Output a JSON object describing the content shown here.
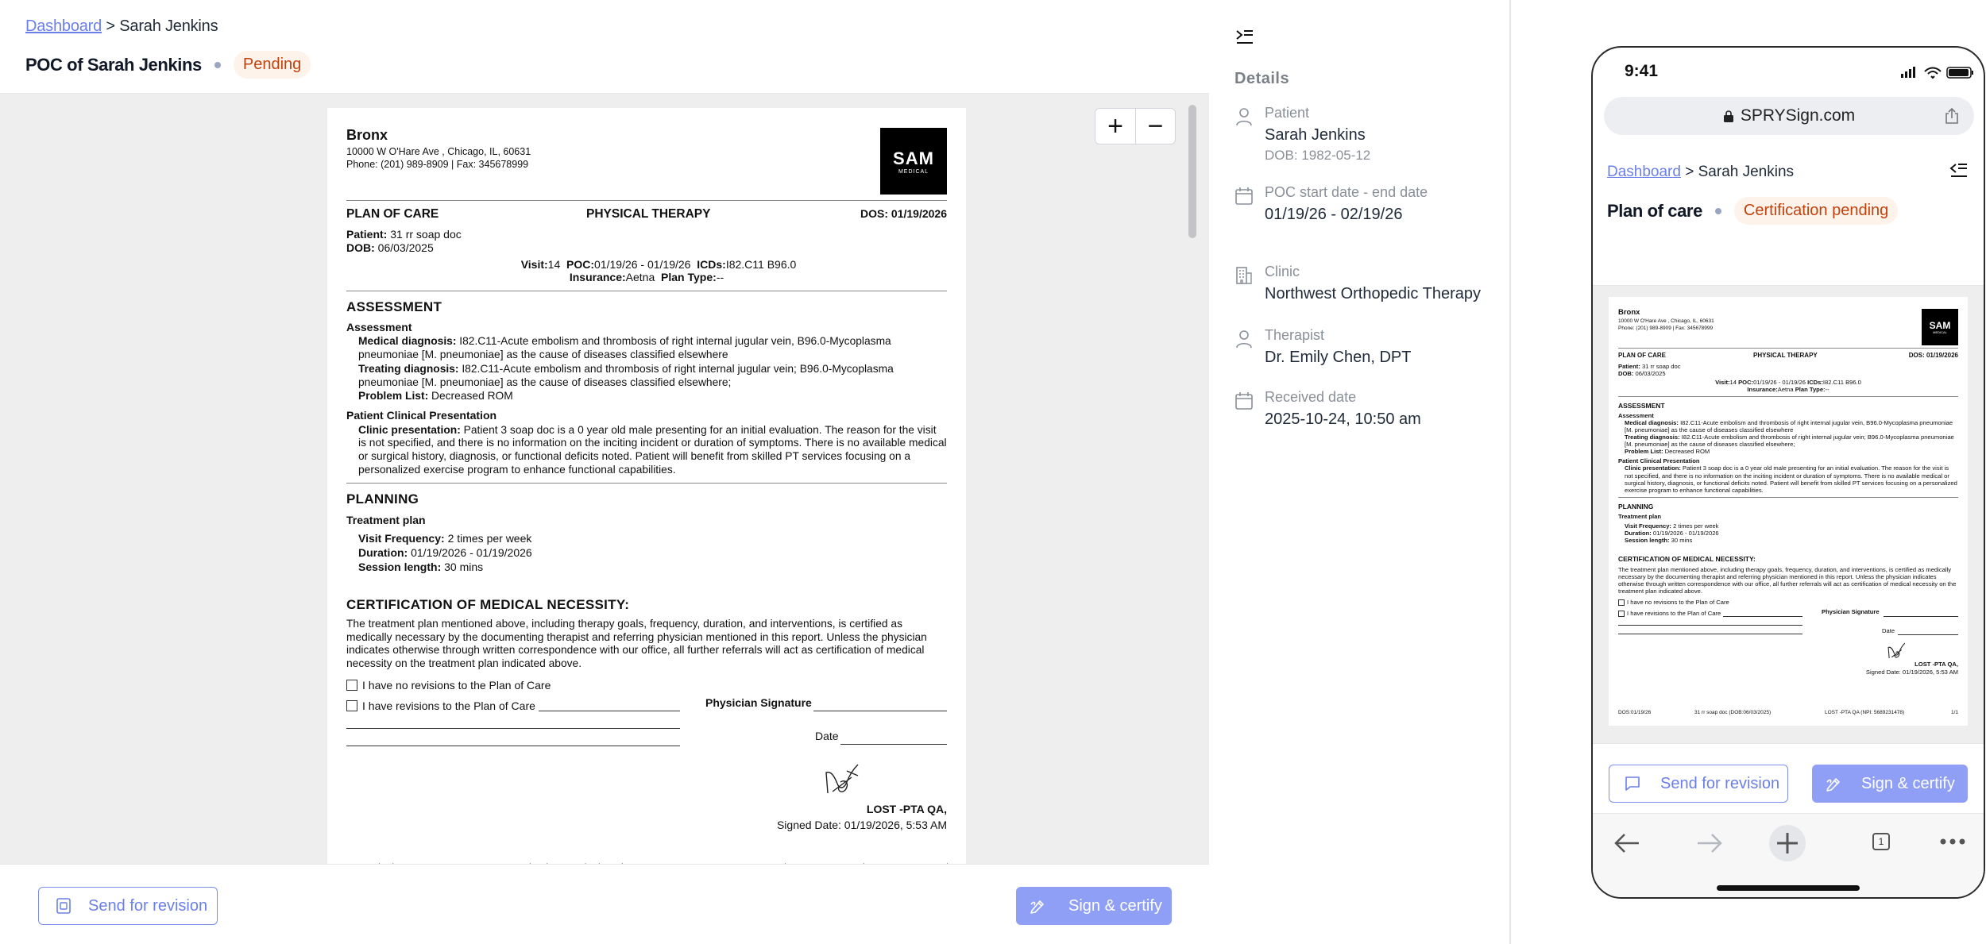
{
  "breadcrumb": {
    "link": "Dashboard",
    "separator": ">",
    "current": "Sarah Jenkins"
  },
  "header": {
    "title": "POC of Sarah Jenkins",
    "status": "Pending"
  },
  "zoom": {
    "plus": "+",
    "minus": "−"
  },
  "document": {
    "clinic_name": "Bronx",
    "address": "10000 W O'Hare Ave , Chicago, IL, 60631",
    "phone_fax": "Phone: (201) 989-8909 | Fax: 345678999",
    "logo_text": "SAM",
    "logo_sub": "MEDICAL",
    "plan_title": "PLAN OF CARE",
    "discipline": "PHYSICAL THERAPY",
    "dos": "DOS: 01/19/2026",
    "patient_label": "Patient:",
    "patient_value": "31 rr soap doc",
    "dob_label": "DOB:",
    "dob_value": "06/03/2025",
    "visit_label": "Visit:",
    "visit_value": "14",
    "poc_label": "POC:",
    "poc_value": "01/19/26 - 01/19/26",
    "icds_label": "ICDs:",
    "icds_value": "I82.C11 B96.0",
    "insurance_label": "Insurance:",
    "insurance_value": "Aetna",
    "plantype_label": "Plan Type:",
    "plantype_value": "--",
    "assessment_heading": "ASSESSMENT",
    "assessment_sub": "Assessment",
    "medical_dx_label": "Medical diagnosis:",
    "medical_dx_value": "I82.C11-Acute embolism and thrombosis of right internal jugular vein, B96.0-Mycoplasma pneumoniae [M. pneumoniae] as the cause of diseases classified elsewhere",
    "treating_dx_label": "Treating diagnosis:",
    "treating_dx_value": "I82.C11-Acute embolism and thrombosis of right internal jugular vein; B96.0-Mycoplasma pneumoniae [M. pneumoniae] as the cause of diseases classified elsewhere;",
    "problem_label": "Problem List:",
    "problem_value": "Decreased ROM",
    "clinical_heading": "Patient Clinical Presentation",
    "clinical_label": "Clinic presentation:",
    "clinical_value": "Patient 3 soap doc is a 0 year old male presenting for an initial evaluation. The reason for the visit is not specified, and there is no information on the inciting incident or duration of symptoms. There is no available medical or surgical history, diagnosis, or functional deficits noted. Patient will benefit from skilled PT services focusing on a personalized exercise program to enhance functional capabilities.",
    "planning_heading": "PLANNING",
    "treatment_plan": "Treatment plan",
    "freq_label": "Visit Frequency:",
    "freq_value": "2 times per week",
    "duration_label": "Duration:",
    "duration_value": "01/19/2026 - 01/19/2026",
    "session_label": "Session length:",
    "session_value": "30 mins",
    "cert_heading": "CERTIFICATION OF MEDICAL NECESSITY:",
    "cert_text": "The treatment plan mentioned above, including therapy goals, frequency, duration, and interventions, is certified as medically necessary by the documenting therapist and referring physician mentioned in this report. Unless the physician indicates otherwise through written correspondence with our office, all further referrals will act as certification of medical necessity on the treatment plan indicated above.",
    "no_revisions": "I have no revisions to the Plan of Care",
    "has_revisions": "I have revisions to the Plan of Care",
    "physician_sig": "Physician Signature",
    "date_label": "Date",
    "signer": "LOST -PTA QA,",
    "signed_date": "Signed Date: 01/19/2026, 5:53 AM",
    "footer_dos": "DOS:01/19/26",
    "footer_patient": "31 rr soap doc (DOB:06/03/2025)",
    "footer_provider": "LOST -PTA QA (NPI: 5689231478)",
    "footer_page": "1/1"
  },
  "actions": {
    "send_revision": "Send for revision",
    "sign_certify": "Sign & certify"
  },
  "details": {
    "heading": "Details",
    "patient_label": "Patient",
    "patient_name": "Sarah Jenkins",
    "patient_dob": "DOB: 1982-05-12",
    "poc_label": "POC start date - end date",
    "poc_value": "01/19/26 - 02/19/26",
    "clinic_label": "Clinic",
    "clinic_value": "Northwest Orthopedic Therapy",
    "therapist_label": "Therapist",
    "therapist_value": "Dr. Emily Chen, DPT",
    "received_label": "Received date",
    "received_value": "2025-10-24, 10:50 am"
  },
  "mobile": {
    "time": "9:41",
    "url": "SPRYSign.com",
    "title": "Plan of care",
    "status": "Certification pending",
    "tab_count": "1"
  },
  "colors": {
    "accent": "#6b7fe8",
    "button_fill": "#8e9ff5",
    "pending_text": "#c2410c",
    "pending_bg": "#fdf3ea"
  }
}
